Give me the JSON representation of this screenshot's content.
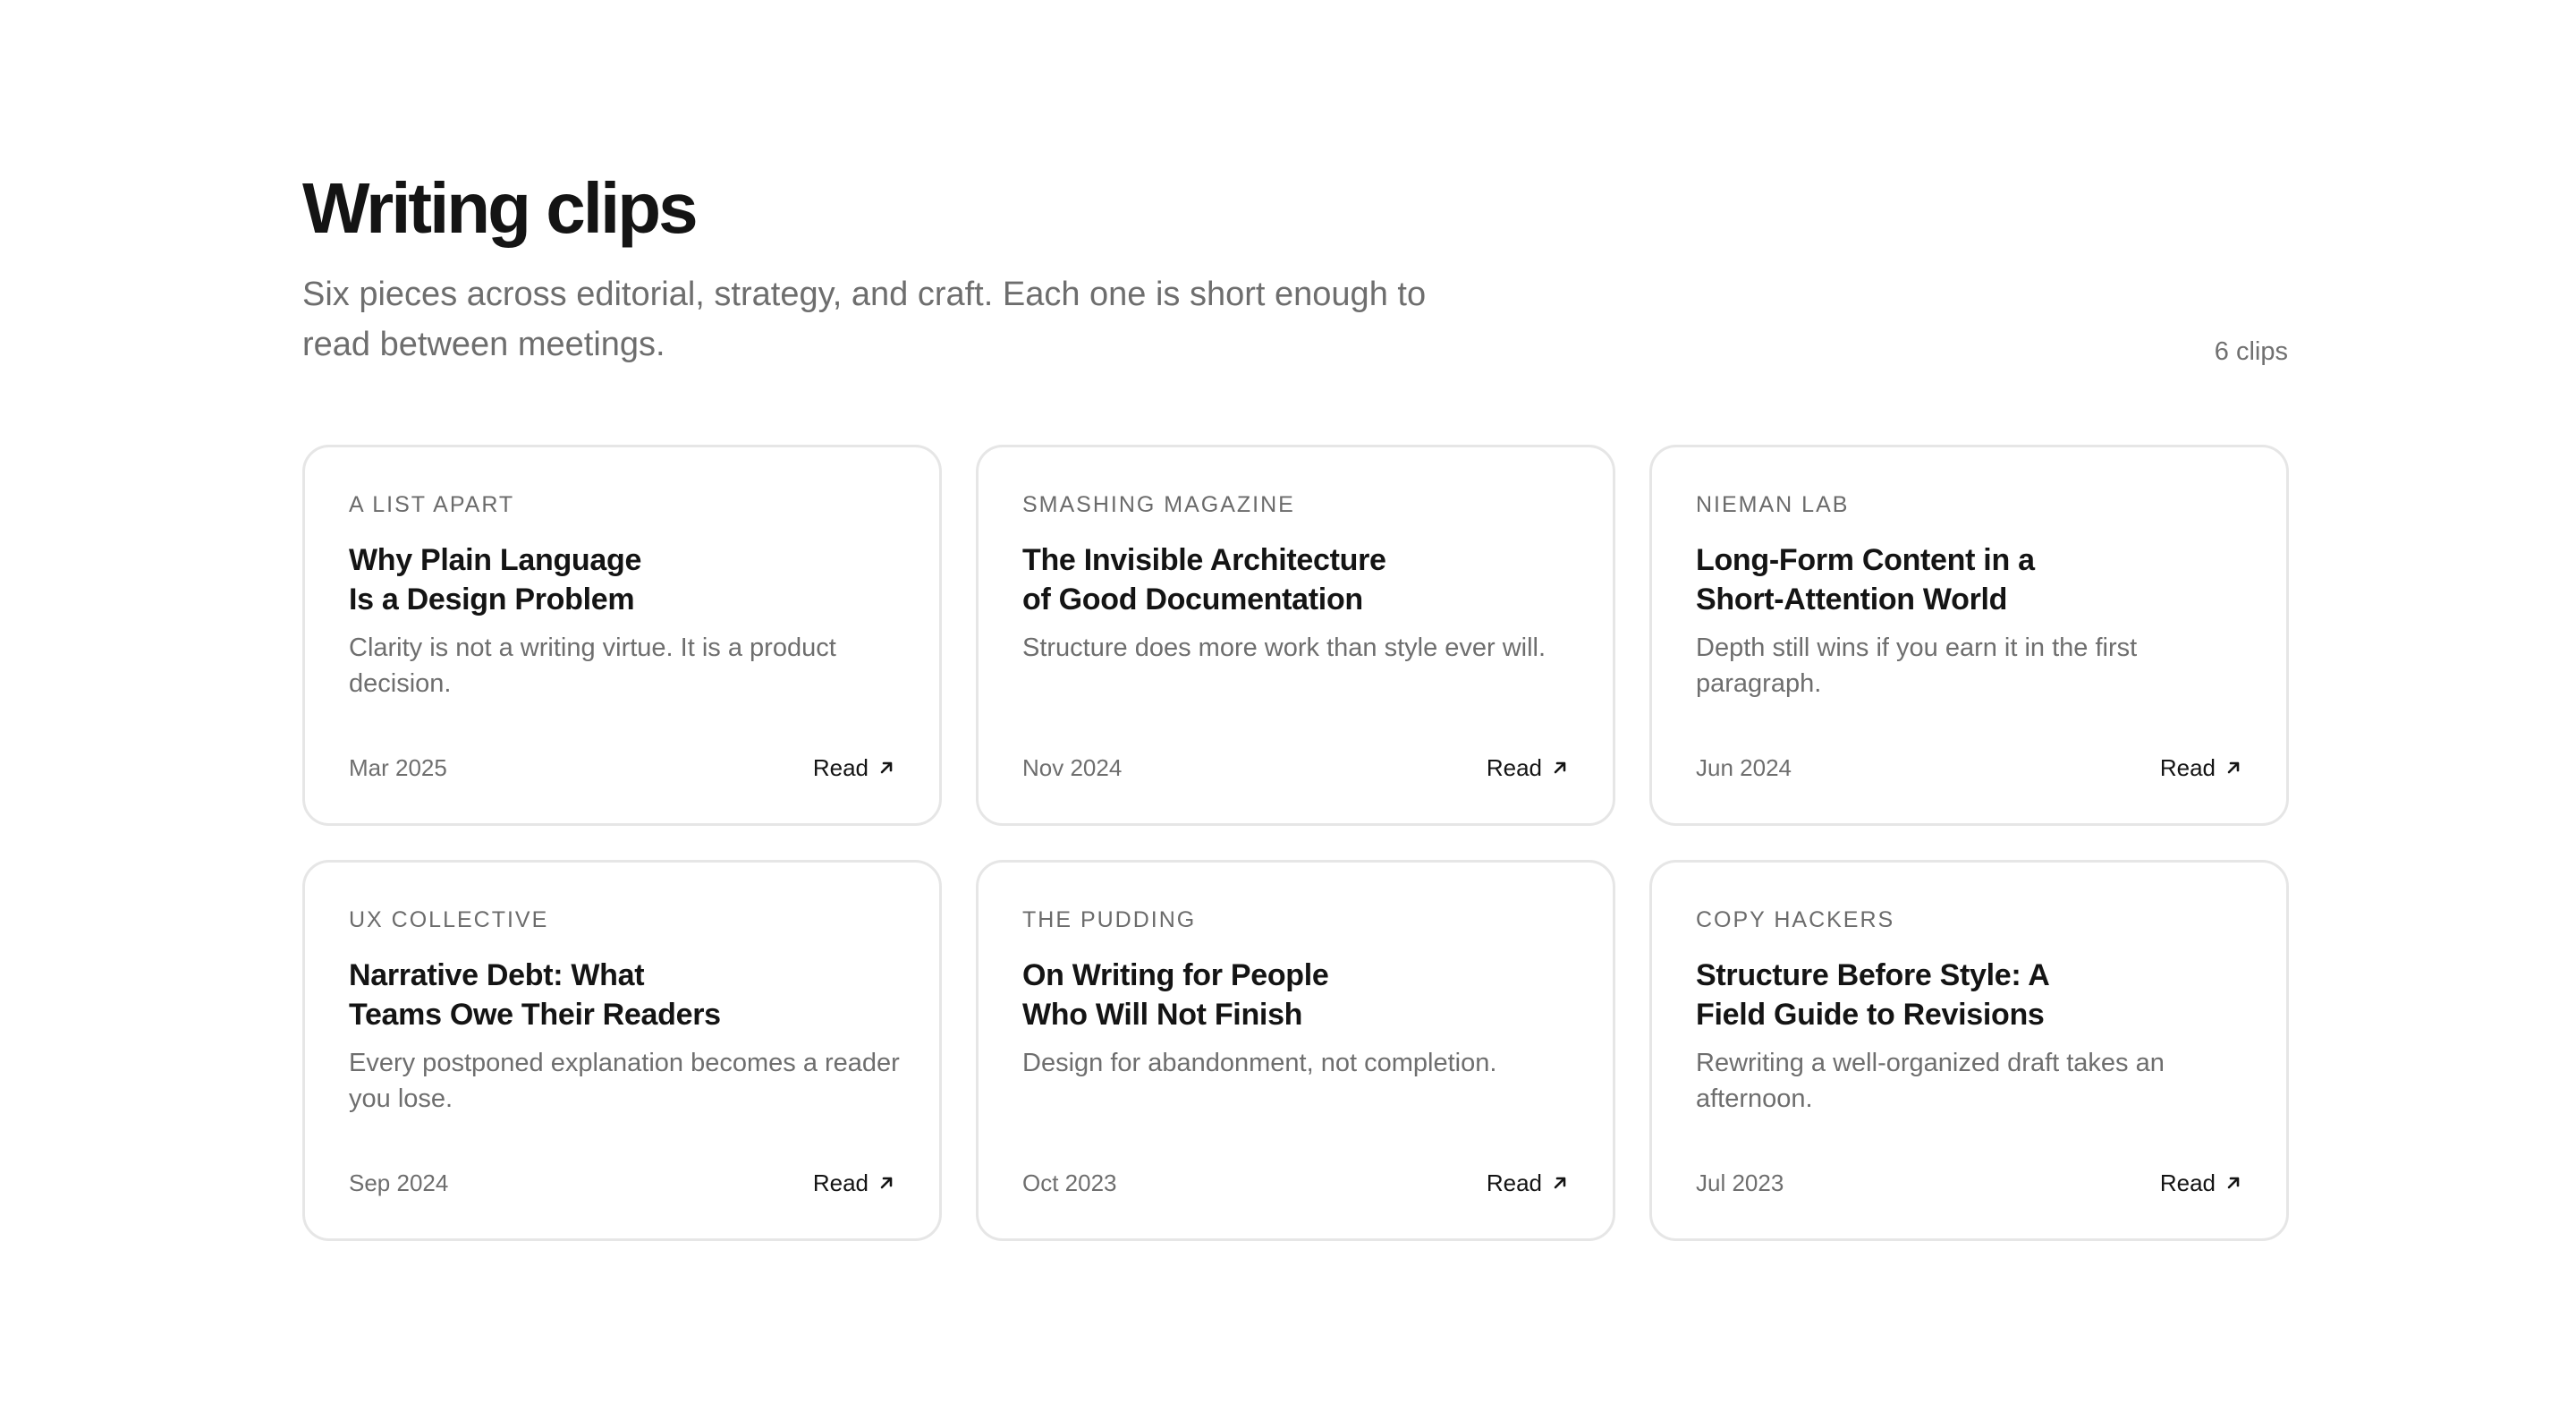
{
  "header": {
    "title": "Writing clips",
    "subtitle": "Six pieces across editorial, strategy, and craft. Each one is short enough to read between meetings.",
    "count": "6 clips"
  },
  "clips": [
    {
      "publication": "A LIST APART",
      "title": "Why Plain Language\nIs a Design Problem",
      "description": "Clarity is not a writing virtue. It is a product decision.",
      "date": "Mar 2025",
      "link_label": "Read",
      "icon": "arrow-up-right-icon"
    },
    {
      "publication": "SMASHING MAGAZINE",
      "title": "The Invisible Architecture\nof Good Documentation",
      "description": "Structure does more work than style ever will.",
      "date": "Nov 2024",
      "link_label": "Read",
      "icon": "arrow-up-right-icon"
    },
    {
      "publication": "NIEMAN LAB",
      "title": "Long-Form Content in a\nShort-Attention World",
      "description": "Depth still wins if you earn it in the first paragraph.",
      "date": "Jun 2024",
      "link_label": "Read",
      "icon": "arrow-up-right-icon"
    },
    {
      "publication": "UX COLLECTIVE",
      "title": "Narrative Debt: What\nTeams Owe Their Readers",
      "description": "Every postponed explanation becomes a reader you lose.",
      "date": "Sep 2024",
      "link_label": "Read",
      "icon": "arrow-up-right-icon"
    },
    {
      "publication": "THE PUDDING",
      "title": "On Writing for People\nWho Will Not Finish",
      "description": "Design for abandonment, not completion.",
      "date": "Oct 2023",
      "link_label": "Read",
      "icon": "arrow-up-right-icon"
    },
    {
      "publication": "COPY HACKERS",
      "title": "Structure Before Style: A\nField Guide to Revisions",
      "description": "Rewriting a well-organized draft takes an afternoon.",
      "date": "Jul 2023",
      "link_label": "Read",
      "icon": "arrow-up-right-icon"
    }
  ],
  "colors": {
    "text_primary": "#141414",
    "text_muted": "#6e6e6e",
    "card_border": "#e6e6e6",
    "background": "#ffffff"
  }
}
